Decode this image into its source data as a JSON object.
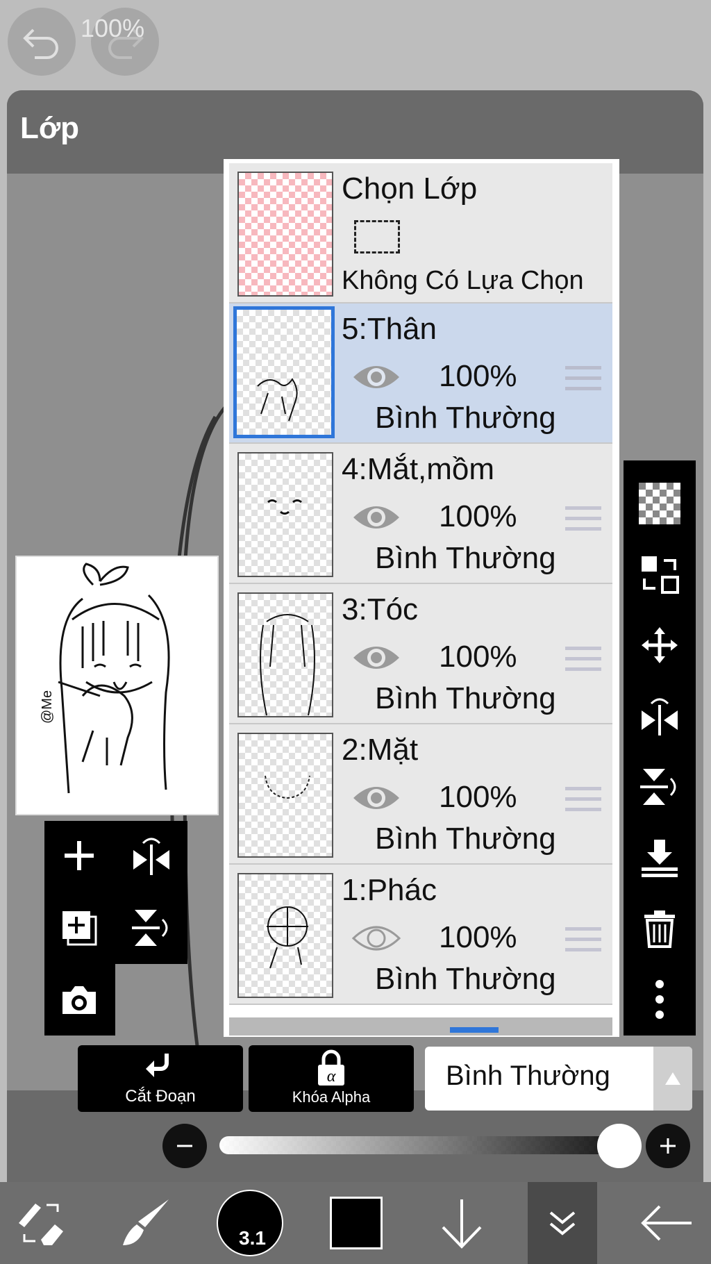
{
  "top": {
    "undo_icon": "undo-arrow-icon",
    "redo_icon": "redo-arrow-icon"
  },
  "panel": {
    "title": "Lớp"
  },
  "selection": {
    "title": "Chọn Lớp",
    "status": "Không Có Lựa Chọn"
  },
  "layers": [
    {
      "name": "5:Thân",
      "opacity": "100%",
      "blend": "Bình Thường",
      "visible": true,
      "selected": true
    },
    {
      "name": "4:Mắt,mồm",
      "opacity": "100%",
      "blend": "Bình Thường",
      "visible": true,
      "selected": false
    },
    {
      "name": "3:Tóc",
      "opacity": "100%",
      "blend": "Bình Thường",
      "visible": true,
      "selected": false
    },
    {
      "name": "2:Mặt",
      "opacity": "100%",
      "blend": "Bình Thường",
      "visible": true,
      "selected": false
    },
    {
      "name": "1:Phác",
      "opacity": "100%",
      "blend": "Bình Thường",
      "visible": false,
      "selected": false
    }
  ],
  "preview": {
    "signature": "@Me"
  },
  "controls": {
    "clipping_label": "Cắt Đoạn",
    "alpha_lock_label": "Khóa Alpha",
    "alpha_glyph": "α",
    "blend_mode": "Bình Thường",
    "opacity_label": "100%",
    "opacity_value": 1.0
  },
  "bottom_bar": {
    "brush_size": "3.1",
    "color": "#000000"
  },
  "colors": {
    "accent": "#2f76d9",
    "selected_row": "#cbd8ec"
  }
}
